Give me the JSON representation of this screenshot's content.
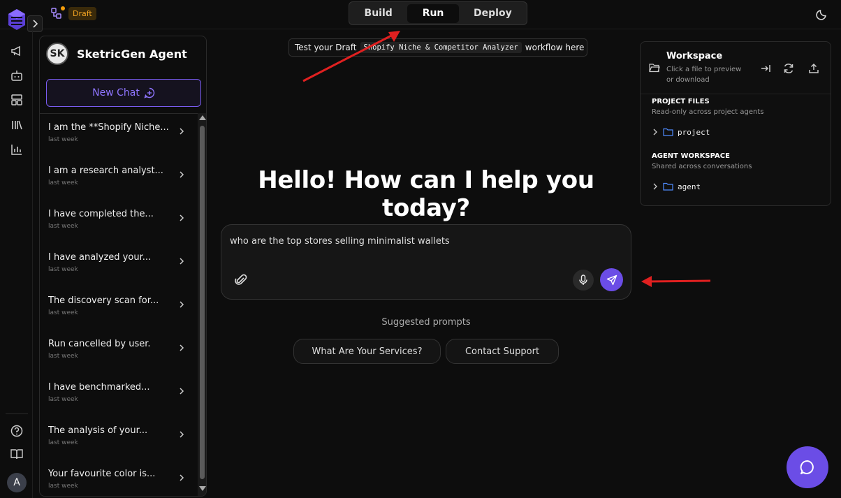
{
  "header": {
    "draft_label": "Draft",
    "tabs": [
      {
        "label": "Build"
      },
      {
        "label": "Run"
      },
      {
        "label": "Deploy"
      }
    ],
    "active_tab": "Run"
  },
  "agent": {
    "initials": "SK",
    "name": "SketricGen Agent",
    "new_chat_label": "New Chat"
  },
  "chats": [
    {
      "title": "I am the **Shopify Niche...",
      "time": "last week"
    },
    {
      "title": "I am a research analyst...",
      "time": "last week"
    },
    {
      "title": "I have completed the...",
      "time": "last week"
    },
    {
      "title": "I have analyzed your...",
      "time": "last week"
    },
    {
      "title": "The discovery scan for...",
      "time": "last week"
    },
    {
      "title": "Run cancelled by user.",
      "time": "last week"
    },
    {
      "title": "I have benchmarked...",
      "time": "last week"
    },
    {
      "title": "The analysis of your...",
      "time": "last week"
    },
    {
      "title": "Your favourite color is...",
      "time": "last week"
    }
  ],
  "banner": {
    "prefix": "Test your Draft",
    "workflow": "Shopify Niche & Competitor Analyzer",
    "suffix": "workflow here"
  },
  "hero": "Hello! How can I help you today?",
  "composer": {
    "value": "who are the top stores selling minimalist wallets"
  },
  "suggestions": {
    "title": "Suggested prompts",
    "items": [
      "What Are Your Services?",
      "Contact Support"
    ]
  },
  "workspace": {
    "title": "Workspace",
    "subtitle": "Click a file to preview or download",
    "project_heading": "PROJECT FILES",
    "project_sub": "Read-only across project agents",
    "project_folder": "project",
    "agent_heading": "AGENT WORKSPACE",
    "agent_sub": "Shared across conversations",
    "agent_folder": "agent"
  },
  "user_initial": "A",
  "colors": {
    "accent": "#6b4de6",
    "draft": "#f5a623",
    "annotation_arrow": "#e02020"
  }
}
